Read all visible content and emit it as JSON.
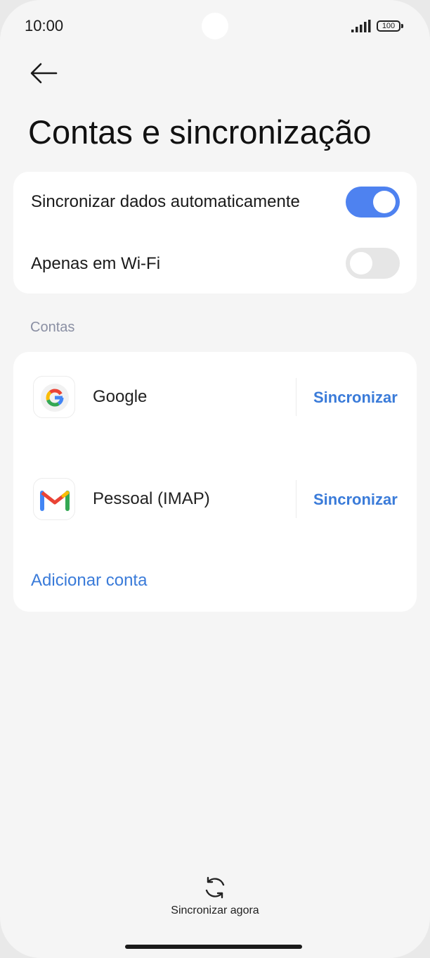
{
  "status_bar": {
    "time": "10:00",
    "battery": "100"
  },
  "header": {
    "title": "Contas e sincronização"
  },
  "sync_settings": {
    "auto_sync": {
      "label": "Sincronizar dados automaticamente",
      "enabled": true
    },
    "wifi_only": {
      "label": "Apenas em Wi-Fi",
      "enabled": false
    }
  },
  "accounts": {
    "section_label": "Contas",
    "items": [
      {
        "name": "Google",
        "action": "Sincronizar",
        "icon": "google-icon"
      },
      {
        "name": "Pessoal (IMAP)",
        "action": "Sincronizar",
        "icon": "gmail-icon"
      }
    ],
    "add_label": "Adicionar conta"
  },
  "footer": {
    "sync_now_label": "Sincronizar agora"
  },
  "colors": {
    "accent": "#3a7bd9",
    "toggle_on": "#4e82f0",
    "toggle_off": "#e6e6e6",
    "background": "#f5f5f5"
  }
}
